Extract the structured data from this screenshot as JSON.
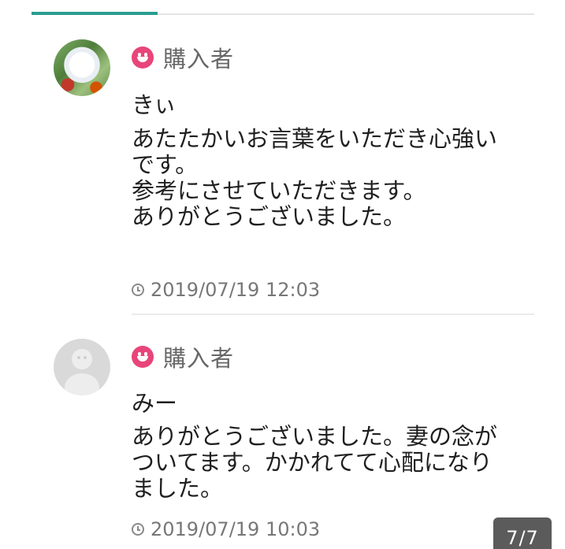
{
  "comments": [
    {
      "badge_icon": "smiley-icon",
      "badge": "購入者",
      "avatar": "snow-bird-photo",
      "name": "きぃ",
      "text": "あたたかいお言葉をいただき心強い\nです。\n参考にさせていただきます。\nありがとうございました。",
      "timestamp": "2019/07/19 12:03"
    },
    {
      "badge_icon": "smiley-icon",
      "badge": "購入者",
      "avatar": "default-avatar",
      "name": "みー",
      "text": "ありがとうございました。妻の念が\nついてます。かかれてて心配になり\nました。",
      "timestamp": "2019/07/19 10:03"
    }
  ],
  "page_counter": "7/7",
  "colors": {
    "tab_indicator": "#2a9d8f",
    "buyer_icon": "#e8457a",
    "text_secondary": "#777777"
  }
}
